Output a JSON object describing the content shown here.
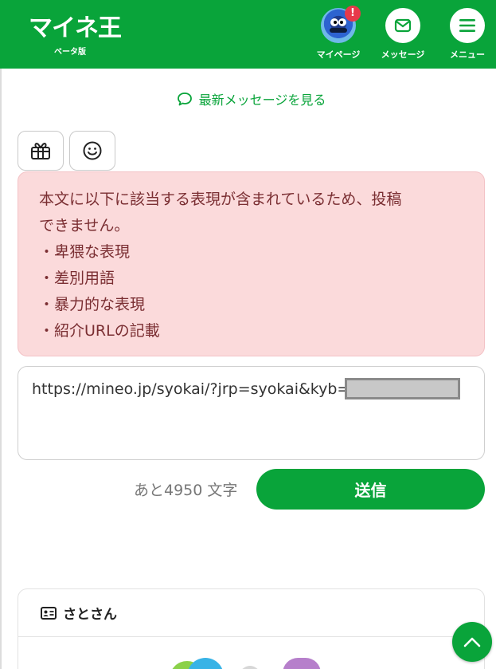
{
  "header": {
    "logo_text": "マイネ王",
    "logo_sub": "ベータ版",
    "nav": [
      {
        "label": "マイページ",
        "badge": "!"
      },
      {
        "label": "メッセージ"
      },
      {
        "label": "メニュー"
      }
    ]
  },
  "latest_link": "最新メッセージを見る",
  "alert": {
    "lines": [
      "本文に以下に該当する表現が含まれているため、投稿",
      "できません。",
      "・卑猥な表現",
      "・差別用語",
      "・暴力的な表現",
      "・紹介URLの記載"
    ]
  },
  "message_input": {
    "value": "https://mineo.jp/syokai/?jrp=syokai&kyb="
  },
  "counter": "あと4950 文字",
  "send_label": "送信",
  "card": {
    "name": "さとさん"
  },
  "colors": {
    "brand_green": "#09a43a",
    "alert_bg": "#fbdadb",
    "alert_text": "#7a2e32"
  }
}
